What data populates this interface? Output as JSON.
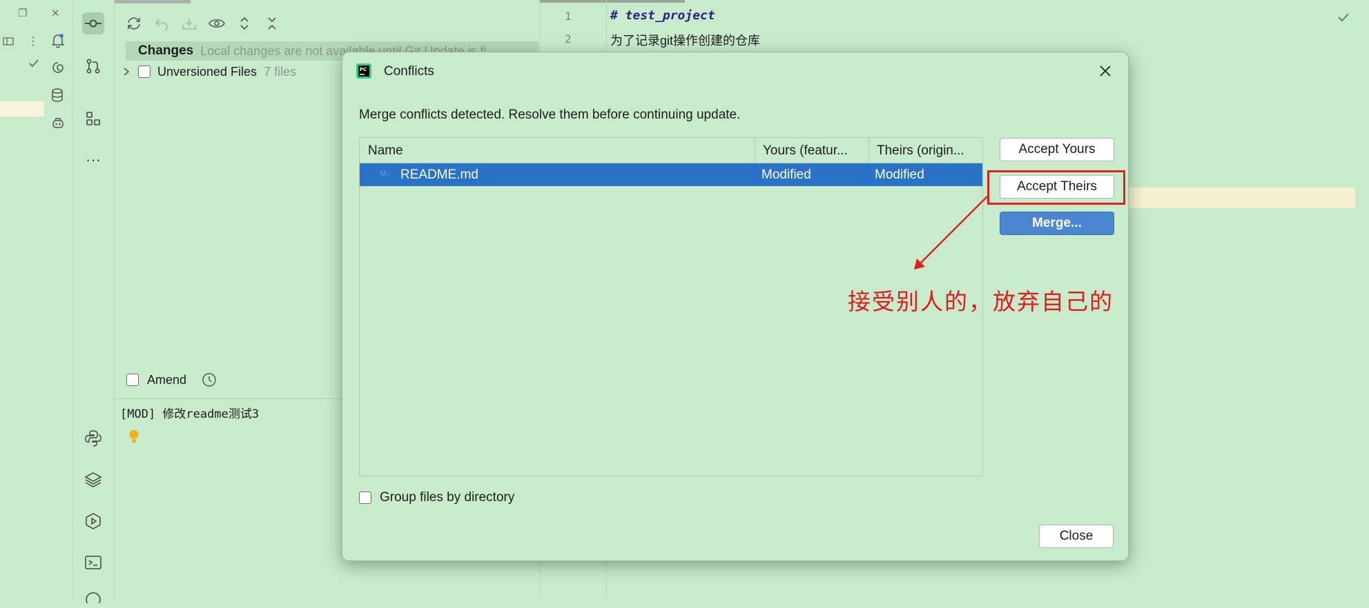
{
  "window": {
    "restore_glyph": "❐",
    "close_glyph": "✕"
  },
  "commit_panel": {
    "changes_title": "Changes",
    "changes_note": "Local changes are not available until Git Update is fi",
    "unversioned_label": "Unversioned Files",
    "unversioned_count": "7 files",
    "amend_label": "Amend",
    "commit_message": "[MOD] 修改readme测试3"
  },
  "editor": {
    "lines": [
      {
        "number": "1",
        "text": "# test_project"
      },
      {
        "number": "2",
        "text": "为了记录git操作创建的仓库"
      }
    ]
  },
  "dialog": {
    "title": "Conflicts",
    "message": "Merge conflicts detected. Resolve them before continuing update.",
    "columns": [
      "Name",
      "Yours (featur...",
      "Theirs (origin..."
    ],
    "rows": [
      {
        "icon": "M↓",
        "name": "README.md",
        "yours": "Modified",
        "theirs": "Modified"
      }
    ],
    "buttons": {
      "accept_yours": "Accept Yours",
      "accept_theirs": "Accept Theirs",
      "merge": "Merge...",
      "close": "Close"
    },
    "group_by_directory_label": "Group files by directory",
    "annotation": "接受别人的，放弃自己的"
  },
  "colors": {
    "background": "#c8ebcc",
    "selection": "#2873c6",
    "primary_button": "#4a87d0",
    "annotation_red": "#e02020"
  }
}
